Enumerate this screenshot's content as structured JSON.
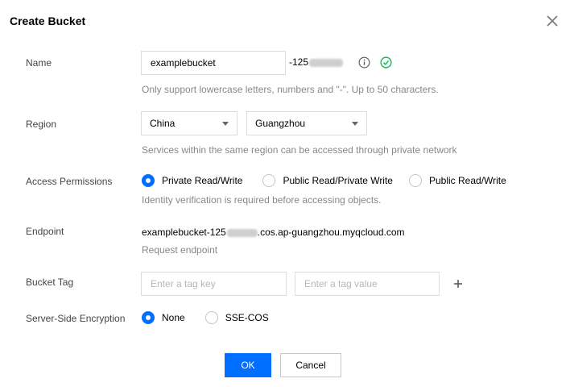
{
  "dialog": {
    "title": "Create Bucket",
    "close_icon": "close-icon"
  },
  "name": {
    "label": "Name",
    "value": "examplebucket",
    "suffix": "-125",
    "hint": "Only support lowercase letters, numbers and \"-\". Up to 50 characters.",
    "info_icon": "info-icon",
    "valid_icon": "check-circle-icon"
  },
  "region": {
    "label": "Region",
    "country": "China",
    "city": "Guangzhou",
    "hint": "Services within the same region can be accessed through private network"
  },
  "access": {
    "label": "Access Permissions",
    "options": [
      "Private Read/Write",
      "Public Read/Private Write",
      "Public Read/Write"
    ],
    "selected": "Private Read/Write",
    "hint": "Identity verification is required before accessing objects."
  },
  "endpoint": {
    "label": "Endpoint",
    "prefix": "examplebucket-125",
    "suffix": ".cos.ap-guangzhou.myqcloud.com",
    "hint": "Request endpoint"
  },
  "tag": {
    "label": "Bucket Tag",
    "key_placeholder": "Enter a tag key",
    "value_placeholder": "Enter a tag value",
    "add_icon": "plus-icon"
  },
  "encryption": {
    "label": "Server-Side Encryption",
    "options": [
      "None",
      "SSE-COS"
    ],
    "selected": "None"
  },
  "footer": {
    "ok_label": "OK",
    "cancel_label": "Cancel"
  },
  "colors": {
    "primary": "#006eff",
    "success": "#0abf5b",
    "hint": "#888888"
  }
}
